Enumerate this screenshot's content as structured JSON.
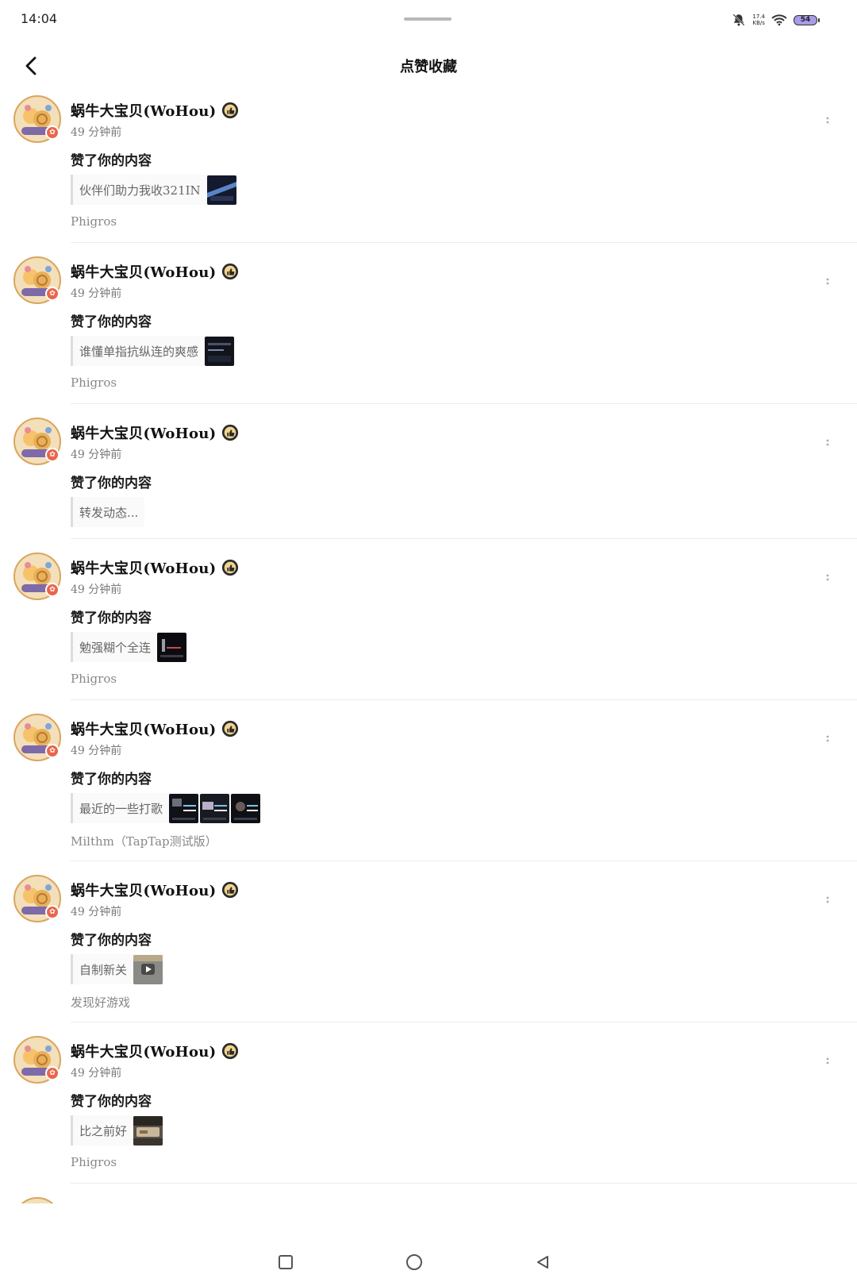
{
  "status_bar": {
    "time": "14:04",
    "net_speed_value": "17.4",
    "net_speed_unit": "KB/s",
    "battery": "54"
  },
  "header": {
    "title": "点赞收藏"
  },
  "notifications": [
    {
      "username": "蜗牛大宝贝(WoHou)",
      "time_ago": "49 分钟前",
      "action": "赞了你的内容",
      "quote": "伙伴们助力我收321IN",
      "thumbs": 1,
      "source": "Phigros"
    },
    {
      "username": "蜗牛大宝贝(WoHou)",
      "time_ago": "49 分钟前",
      "action": "赞了你的内容",
      "quote": "谁懂单指抗纵连的爽感",
      "thumbs": 1,
      "source": "Phigros"
    },
    {
      "username": "蜗牛大宝贝(WoHou)",
      "time_ago": "49 分钟前",
      "action": "赞了你的内容",
      "quote": "转发动态...",
      "thumbs": 0,
      "source": ""
    },
    {
      "username": "蜗牛大宝贝(WoHou)",
      "time_ago": "49 分钟前",
      "action": "赞了你的内容",
      "quote": "勉强糊个全连",
      "thumbs": 1,
      "source": "Phigros"
    },
    {
      "username": "蜗牛大宝贝(WoHou)",
      "time_ago": "49 分钟前",
      "action": "赞了你的内容",
      "quote": "最近的一些打歌",
      "thumbs": 3,
      "source": "Milthm（TapTap测试版）"
    },
    {
      "username": "蜗牛大宝贝(WoHou)",
      "time_ago": "49 分钟前",
      "action": "赞了你的内容",
      "quote": "自制新关",
      "thumbs": 1,
      "source": "发现好游戏"
    },
    {
      "username": "蜗牛大宝贝(WoHou)",
      "time_ago": "49 分钟前",
      "action": "赞了你的内容",
      "quote": "比之前好",
      "thumbs": 1,
      "source": "Phigros"
    }
  ],
  "icons": {
    "back": "chevron-left-icon",
    "more": "more-vertical-icon",
    "medal": "thumbs-up-medal-icon",
    "nav_recent": "square-icon",
    "nav_home": "circle-icon",
    "nav_back": "triangle-back-icon"
  },
  "colors": {
    "battery": "#a99be8",
    "badge": "#e9664b",
    "divider": "#ececec"
  }
}
